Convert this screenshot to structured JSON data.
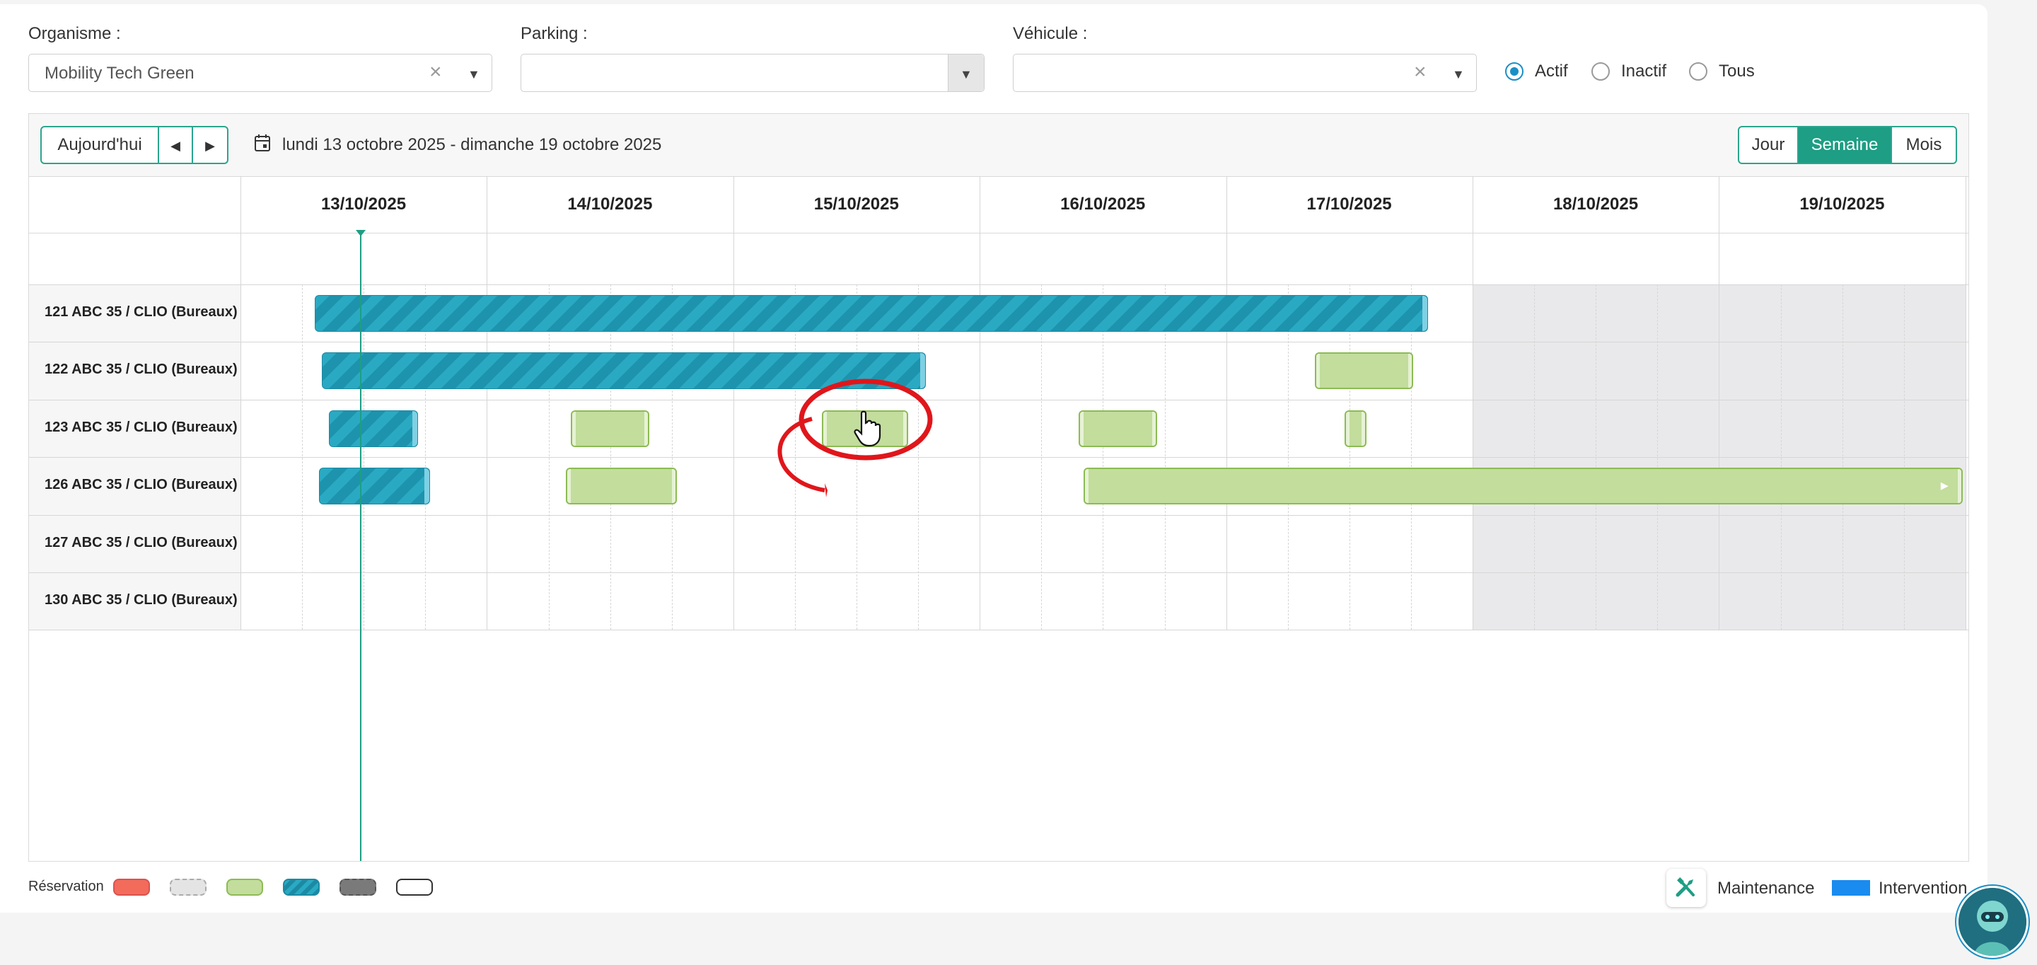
{
  "filters": {
    "organisme": {
      "label": "Organisme :",
      "value": "Mobility Tech Green"
    },
    "parking": {
      "label": "Parking :",
      "value": ""
    },
    "vehicule": {
      "label": "Véhicule :",
      "value": ""
    },
    "status_options": [
      {
        "label": "Actif",
        "selected": true
      },
      {
        "label": "Inactif",
        "selected": false
      },
      {
        "label": "Tous",
        "selected": false
      }
    ]
  },
  "toolbar": {
    "today_label": "Aujourd'hui",
    "prev_icon": "caret-left-icon",
    "next_icon": "caret-right-icon",
    "date_range": "lundi 13 octobre 2025 - dimanche 19 octobre 2025",
    "views": [
      {
        "label": "Jour",
        "active": false
      },
      {
        "label": "Semaine",
        "active": true
      },
      {
        "label": "Mois",
        "active": false
      }
    ]
  },
  "days": [
    "13/10/2025",
    "14/10/2025",
    "15/10/2025",
    "16/10/2025",
    "17/10/2025",
    "18/10/2025",
    "19/10/2025"
  ],
  "vehicles": [
    "121 ABC 35 / CLIO (Bureaux)",
    "122 ABC 35 / CLIO (Bureaux)",
    "123 ABC 35 / CLIO (Bureaux)",
    "126 ABC 35 / CLIO (Bureaux)",
    "127 ABC 35 / CLIO (Bureaux)",
    "130 ABC 35 / CLIO (Bureaux)"
  ],
  "reservations": [
    {
      "vehicle": 0,
      "type": "teal",
      "start_day": 0.3,
      "end_day": 4.82
    },
    {
      "vehicle": 1,
      "type": "teal",
      "start_day": 0.33,
      "end_day": 2.78
    },
    {
      "vehicle": 1,
      "type": "green",
      "start_day": 4.36,
      "end_day": 4.76
    },
    {
      "vehicle": 2,
      "type": "teal",
      "start_day": 0.36,
      "end_day": 0.72
    },
    {
      "vehicle": 2,
      "type": "green",
      "start_day": 1.34,
      "end_day": 1.66
    },
    {
      "vehicle": 2,
      "type": "green",
      "start_day": 2.36,
      "end_day": 2.71
    },
    {
      "vehicle": 2,
      "type": "green",
      "start_day": 3.4,
      "end_day": 3.72
    },
    {
      "vehicle": 2,
      "type": "green",
      "start_day": 4.48,
      "end_day": 4.57
    },
    {
      "vehicle": 3,
      "type": "teal",
      "start_day": 0.32,
      "end_day": 0.77
    },
    {
      "vehicle": 3,
      "type": "green",
      "start_day": 1.32,
      "end_day": 1.77
    },
    {
      "vehicle": 3,
      "type": "green",
      "start_day": 3.42,
      "end_day": 7.0,
      "continues": true
    }
  ],
  "legend": {
    "label": "Réservation",
    "swatches": [
      {
        "fill": "#f26b5b",
        "border": "#d9534f",
        "style": "solid"
      },
      {
        "fill": "#e4e4e4",
        "border": "#aaaaaa",
        "style": "dashed"
      },
      {
        "fill": "#c2dd9c",
        "border": "#8dbb55",
        "style": "solid"
      },
      {
        "fill": "#2aa9c3",
        "border": "#1c8aa3",
        "style": "striped"
      },
      {
        "fill": "#7a7a7a",
        "border": "#555555",
        "style": "dashed"
      },
      {
        "fill": "#ffffff",
        "border": "#333333",
        "style": "solid"
      }
    ],
    "maintenance_label": "Maintenance",
    "maintenance_icon": "tools-icon",
    "intervention_label": "Intervention",
    "intervention_color": "#1a8bef"
  },
  "colors": {
    "accent": "#1e9e84",
    "weekend": "#e9e9ec",
    "annotation": "#e0161b"
  }
}
